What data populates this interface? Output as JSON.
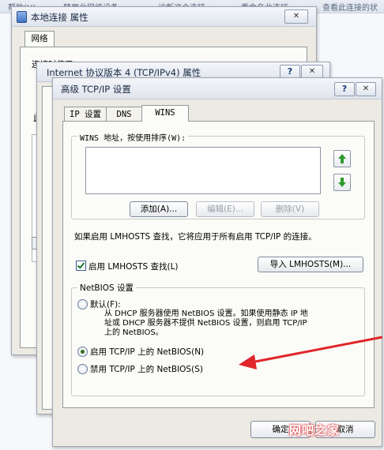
{
  "background": {
    "items": [
      "帮助(H)",
      "禁用此网络设备",
      "诊断这个连接",
      "重命名此连接",
      "查看此连接的状"
    ]
  },
  "window1": {
    "title": "本地连接 属性",
    "close": "✕",
    "tab": "网络",
    "label_connect_using": "连接时使用："
  },
  "window2": {
    "title": "Internet 协议版本 4 (TCP/IPv4) 属性",
    "help": "?",
    "close": "✕"
  },
  "dialog": {
    "title": "高级 TCP/IP 设置",
    "help": "?",
    "close": "✕",
    "tabs": [
      "IP 设置",
      "DNS",
      "WINS"
    ],
    "active_tab": "WINS",
    "wins_list_label": "WINS 地址，按使用排序(W):",
    "wins_addresses": [],
    "buttons": {
      "add": "添加(A)...",
      "edit": "编辑(E)...",
      "delete": "删除(V)"
    },
    "lmhosts_info": "如果启用 LMHOSTS 查找，它将应用于所有启用 TCP/IP 的连接。",
    "enable_lmhosts": {
      "label": "启用 LMHOSTS 查找(L)",
      "checked": true
    },
    "import_lmhosts": "导入 LMHOSTS(M)...",
    "netbios": {
      "group_label": "NetBIOS 设置",
      "selected": "enable",
      "options": {
        "default": {
          "label": "默认(F):",
          "desc_line1": "从 DHCP 服务器使用 NetBIOS 设置。如果使用静态 IP 地",
          "desc_line2": "址或 DHCP 服务器不提供 NetBIOS 设置，则启用 TCP/IP",
          "desc_line3": "上的 NetBIOS。"
        },
        "enable": {
          "label": "启用 TCP/IP 上的 NetBIOS(N)"
        },
        "disable": {
          "label": "禁用 TCP/IP 上的 NetBIOS(S)"
        }
      }
    },
    "ok": "确定",
    "cancel": "取消"
  },
  "watermark": "网吧之家",
  "colors": {
    "arrow": "#e0262b",
    "up_down_arrows": "#2e9a2e",
    "dialog_bg": "#eceae2"
  }
}
